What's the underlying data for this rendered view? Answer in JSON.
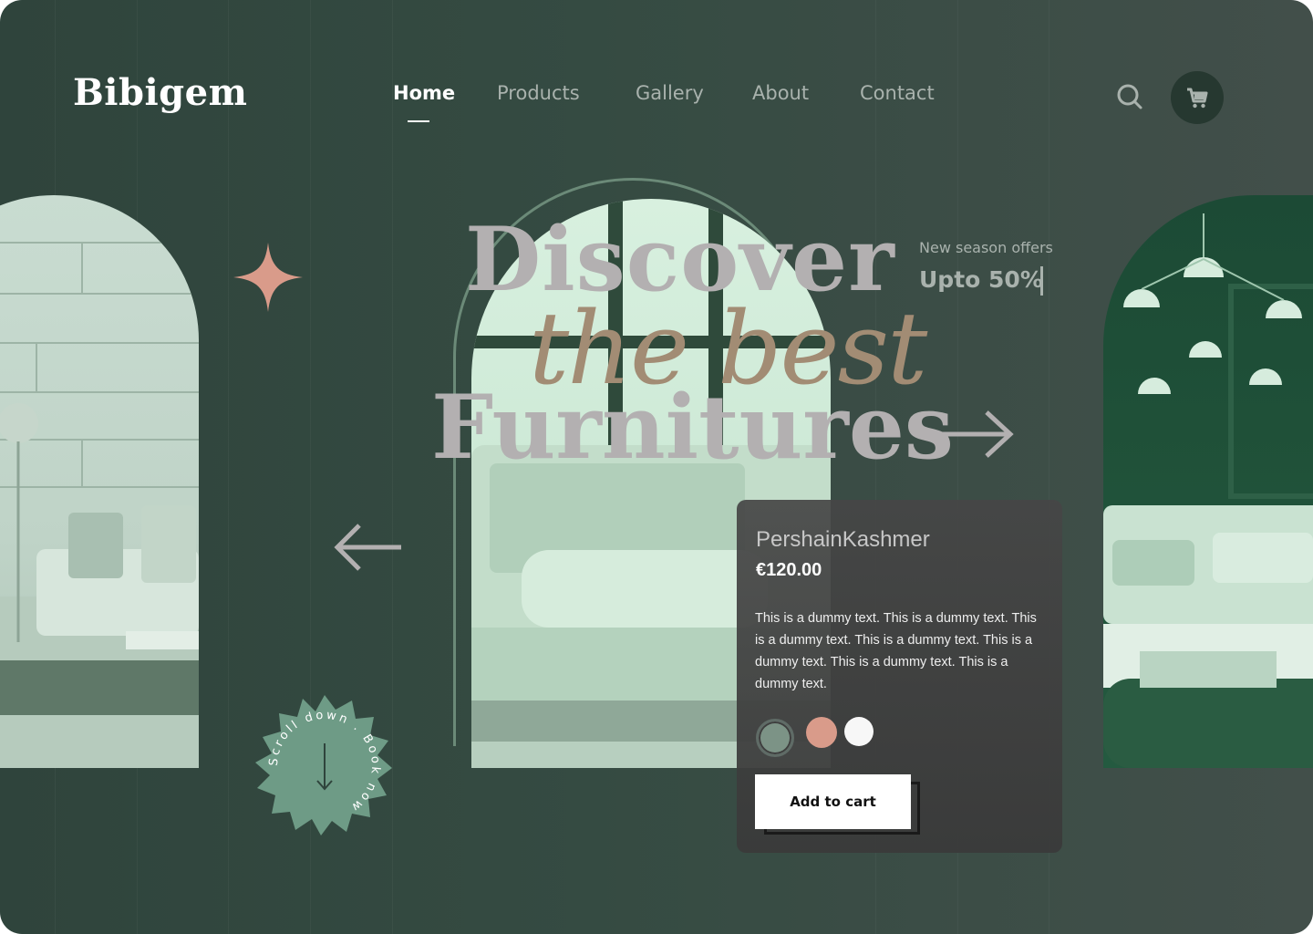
{
  "brand": {
    "name": "Bibigem"
  },
  "nav": {
    "items": [
      {
        "label": "Home",
        "active": true
      },
      {
        "label": "Products",
        "active": false
      },
      {
        "label": "Gallery",
        "active": false
      },
      {
        "label": "About",
        "active": false
      },
      {
        "label": "Contact",
        "active": false
      }
    ]
  },
  "header": {
    "search_icon": "search-icon",
    "cart_icon": "cart-icon"
  },
  "hero": {
    "line1": "Discover",
    "line2": "the best",
    "line3": "Furnitures",
    "offer": {
      "label": "New season offers",
      "value": "Upto 50%"
    }
  },
  "badge": {
    "text": "Scroll down . Book now"
  },
  "product": {
    "name": "PershainKashmer",
    "price": "€120.00",
    "description": "This is a dummy text. This is a dummy text. This is a dummy text. This is a dummy text. This is a dummy text. This is a dummy text. This is a dummy text.",
    "colors": [
      "#7c9386",
      "#d99b8a",
      "#f7f7f7"
    ],
    "add_to_cart_label": "Add to cart"
  },
  "theme": {
    "background": "#354b42",
    "accent": "#d99b8a",
    "card": "#444444"
  }
}
